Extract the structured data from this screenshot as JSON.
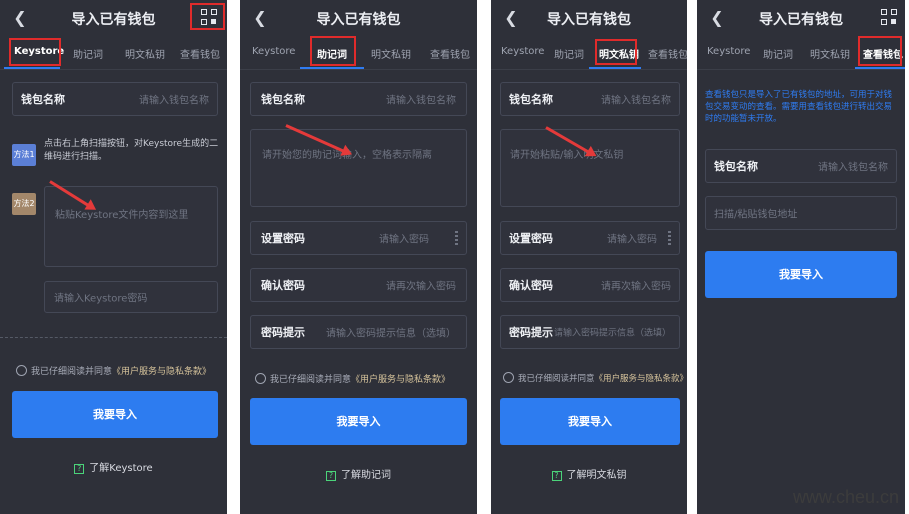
{
  "app_title": "导入已有钱包",
  "tabs": [
    "Keystore",
    "助记词",
    "明文私钥",
    "查看钱包"
  ],
  "colors": {
    "background": "#2e3039",
    "accent": "#2d7cf0",
    "highlight": "#e02b2b",
    "link": "#d6c39b",
    "note": "#2f7cf2"
  },
  "common": {
    "wallet_name_label": "钱包名称",
    "wallet_name_placeholder": "请输入钱包名称",
    "set_password_label": "设置密码",
    "set_password_placeholder": "请输入密码",
    "confirm_password_label": "确认密码",
    "confirm_password_placeholder": "请再次输入密码",
    "hint_label": "密码提示",
    "hint_placeholder": "请输入密码提示信息（选填）",
    "agree_prefix": "我已仔细阅读并同意",
    "agree_link": "《用户服务与隐私条款》",
    "import_button": "我要导入",
    "help_icon_text": "?"
  },
  "screen1": {
    "method1_badge": "方法1",
    "method1_desc": "点击右上角扫描按钮，对Keystore生成的二维码进行扫描。",
    "method2_badge": "方法2",
    "keystore_placeholder": "粘贴Keystore文件内容到这里",
    "keystore_password_placeholder": "请输入Keystore密码",
    "learn": "了解Keystore"
  },
  "screen2": {
    "mnemonic_placeholder": "请开始您的助记词输入，空格表示隔离",
    "learn": "了解助记词"
  },
  "screen3": {
    "privkey_placeholder": "请开始粘贴/输入明文私钥",
    "learn": "了解明文私钥"
  },
  "screen4": {
    "note": "查看钱包只是导入了已有钱包的地址，可用于对钱包交易变动的查看。需要用查看钱包进行转出交易时的功能暂未开放。",
    "address_placeholder": "扫描/粘贴钱包地址"
  },
  "watermark": "www.cheu.cn"
}
